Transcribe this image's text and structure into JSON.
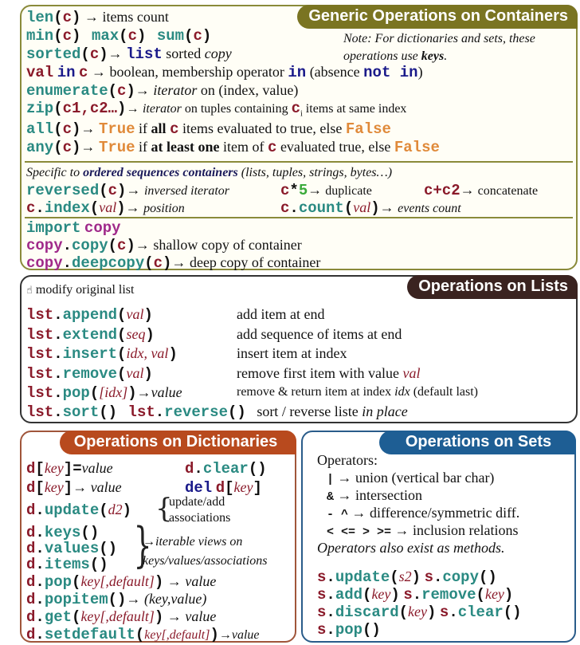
{
  "generic": {
    "title": "Generic Operations on Containers",
    "note_line1": "Note: For dictionaries and sets, these",
    "note_line2a": "operations use ",
    "note_line2b": "keys",
    "note_line2c": ".",
    "len": {
      "fn": "len",
      "arg": "c",
      "desc": "items count"
    },
    "min": "min",
    "max": "max",
    "sum": "sum",
    "c": "c",
    "sorted": {
      "fn": "sorted",
      "kw": "list",
      "desc1": " sorted ",
      "desc2": "copy"
    },
    "in_line": {
      "val": "val",
      "in": "in",
      "c": "c",
      "desc": " boolean, membership operator ",
      "in2": "in",
      "absence": " (absence ",
      "notin": "not in",
      "close": ")"
    },
    "enumerate": {
      "fn": "enumerate",
      "it": "iterator",
      "desc": " on (index, value)"
    },
    "zip": {
      "fn": "zip",
      "args": "c1,c2…",
      "it": "iterator",
      "desc": " on tuples containing ",
      "ci": "c",
      "sub": "i",
      "desc2": " items at same index"
    },
    "all": {
      "fn": "all",
      "true": "True",
      "if": " if ",
      "all": "all",
      "c": "c",
      "rest": " items evaluated to true, else ",
      "false": "False"
    },
    "any": {
      "fn": "any",
      "true": "True",
      "if": " if ",
      "alo": "at least one",
      "of": " item of ",
      "c": "c",
      "rest": " evaluated true, else ",
      "false": "False"
    },
    "ordered_intro": {
      "a": "Specific to ",
      "b": "ordered sequences containers",
      "c": " (lists, tuples, strings, bytes…)"
    },
    "reversed": {
      "fn": "reversed",
      "desc": "inversed iterator"
    },
    "dup": {
      "c": "c",
      "op": "*",
      "n": "5",
      "desc": " duplicate"
    },
    "concat": {
      "expr": "c+c2",
      "desc": " concatenate"
    },
    "index": {
      "obj": "c",
      "fn": "index",
      "arg": "val",
      "desc": "position"
    },
    "count": {
      "obj": "c",
      "fn": "count",
      "arg": "val",
      "desc": "events count"
    },
    "import": {
      "kw": "import",
      "mod": "copy"
    },
    "copy": {
      "mod": "copy",
      "fn": "copy",
      "arg": "c",
      "desc": " shallow copy of container"
    },
    "deepcopy": {
      "mod": "copy",
      "fn": "deepcopy",
      "arg": "c",
      "desc": " deep copy of container"
    },
    "arrow": "→"
  },
  "lists": {
    "title": "Operations on Lists",
    "modify_icon": "☝",
    "modify_label": "modify original list",
    "obj": "lst",
    "rows": [
      {
        "fn": "append",
        "args": "val",
        "desc": "add item at end"
      },
      {
        "fn": "extend",
        "args": "seq",
        "desc": "add sequence of items at end"
      },
      {
        "fn": "insert",
        "args": "idx, val",
        "desc": "insert item at index"
      },
      {
        "fn": "remove",
        "args": "val",
        "desc": "remove first item with value ",
        "desc_it": "val"
      },
      {
        "fn": "pop",
        "args": "[idx]",
        "ret": "→value",
        "desc": "remove & return item at index ",
        "desc_it": "idx",
        "desc_tail": " (default last)"
      }
    ],
    "sort": "sort",
    "reverse": "reverse",
    "sort_desc": "sort / reverse liste ",
    "sort_desc_it": "in place"
  },
  "dicts": {
    "title": "Operations on Dictionaries",
    "obj": "d",
    "set": {
      "key": "key",
      "eq": "=",
      "value": "value"
    },
    "get_item": {
      "key": "key",
      "value": "value"
    },
    "clear": "clear",
    "del": {
      "kw": "del",
      "key": "key"
    },
    "update": {
      "fn": "update",
      "arg": "d2",
      "desc1": "update/add",
      "desc2": "associations"
    },
    "views": {
      "keys": "keys",
      "values": "values",
      "items": "items",
      "desc1": "→iterable views on",
      "desc2": "keys/values/associations"
    },
    "pop": {
      "fn": "pop",
      "arg": "key[,default]",
      "ret": "value"
    },
    "popitem": {
      "fn": "popitem",
      "ret": "(key,value)"
    },
    "get": {
      "fn": "get",
      "arg": "key[,default]",
      "ret": "value"
    },
    "setdefault": {
      "fn": "setdefault",
      "arg": "key[,default]",
      "ret": "→value"
    }
  },
  "sets": {
    "title": "Operations on Sets",
    "operators_label": "Operators:",
    "ops": [
      {
        "sym": "|",
        "desc": " union (vertical bar char)"
      },
      {
        "sym": "&",
        "desc": " intersection"
      },
      {
        "sym": "- ^",
        "desc": " difference/symmetric diff."
      },
      {
        "sym": "< <= > >=",
        "desc": " inclusion relations"
      }
    ],
    "methods_note": "Operators also exist as methods.",
    "obj": "s",
    "update": {
      "fn": "update",
      "arg": "s2"
    },
    "copy": "copy",
    "add": {
      "fn": "add",
      "arg": "key"
    },
    "remove": {
      "fn": "remove",
      "arg": "key"
    },
    "discard": {
      "fn": "discard",
      "arg": "key"
    },
    "clear": "clear",
    "pop": "pop"
  }
}
